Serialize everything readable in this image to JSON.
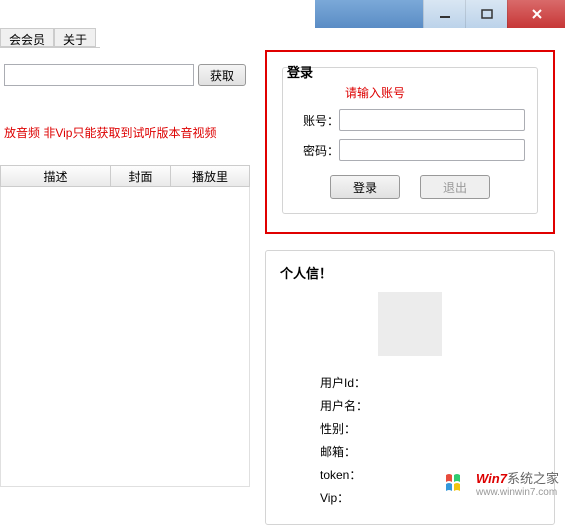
{
  "window": {
    "min": "minimize",
    "max": "maximize",
    "close": "close"
  },
  "menu": {
    "member": "会会员",
    "about": "关于"
  },
  "left": {
    "get_btn": "获取",
    "red_msg": "放音频       非Vip只能获取到试听版本音视频",
    "cols": {
      "desc": "描述",
      "cover": "封面",
      "plays": "播放里"
    }
  },
  "login": {
    "title": "登录",
    "error": "请输入账号",
    "account_label": "账号：",
    "password_label": "密码：",
    "login_btn": "登录",
    "logout_btn": "退出"
  },
  "info": {
    "title": "个人信！",
    "user_id": "用户Id：",
    "username": "用户名：",
    "gender": "性别：",
    "email": "邮箱：",
    "token": "token：",
    "vip": "Vip："
  },
  "watermark": {
    "brand_red": "Win7",
    "brand_rest": "系统之家",
    "url": "www.winwin7.com"
  }
}
